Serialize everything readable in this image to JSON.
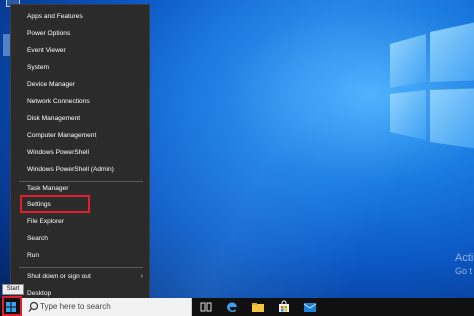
{
  "menu": {
    "items": [
      {
        "label": "Apps and Features"
      },
      {
        "label": "Power Options"
      },
      {
        "label": "Event Viewer"
      },
      {
        "label": "System"
      },
      {
        "label": "Device Manager"
      },
      {
        "label": "Network Connections"
      },
      {
        "label": "Disk Management"
      },
      {
        "label": "Computer Management"
      },
      {
        "label": "Windows PowerShell"
      },
      {
        "label": "Windows PowerShell (Admin)"
      },
      {
        "label": "Task Manager"
      },
      {
        "label": "Settings"
      },
      {
        "label": "File Explorer"
      },
      {
        "label": "Search"
      },
      {
        "label": "Run"
      },
      {
        "label": "Shut down or sign out"
      },
      {
        "label": "Desktop"
      }
    ],
    "submenu_arrow": "›"
  },
  "taskbar": {
    "start_tooltip": "Start",
    "search_placeholder": "Type here to search",
    "icons": [
      "task-view-icon",
      "edge-icon",
      "file-explorer-icon",
      "store-icon",
      "mail-icon"
    ]
  },
  "desktop": {
    "watermark_line1": "Acti",
    "watermark_line2": "Go t"
  },
  "colors": {
    "menu_bg": "#2b2b2b",
    "highlight": "#e41e2b",
    "taskbar_bg": "#101010",
    "accent": "#0078d7"
  }
}
